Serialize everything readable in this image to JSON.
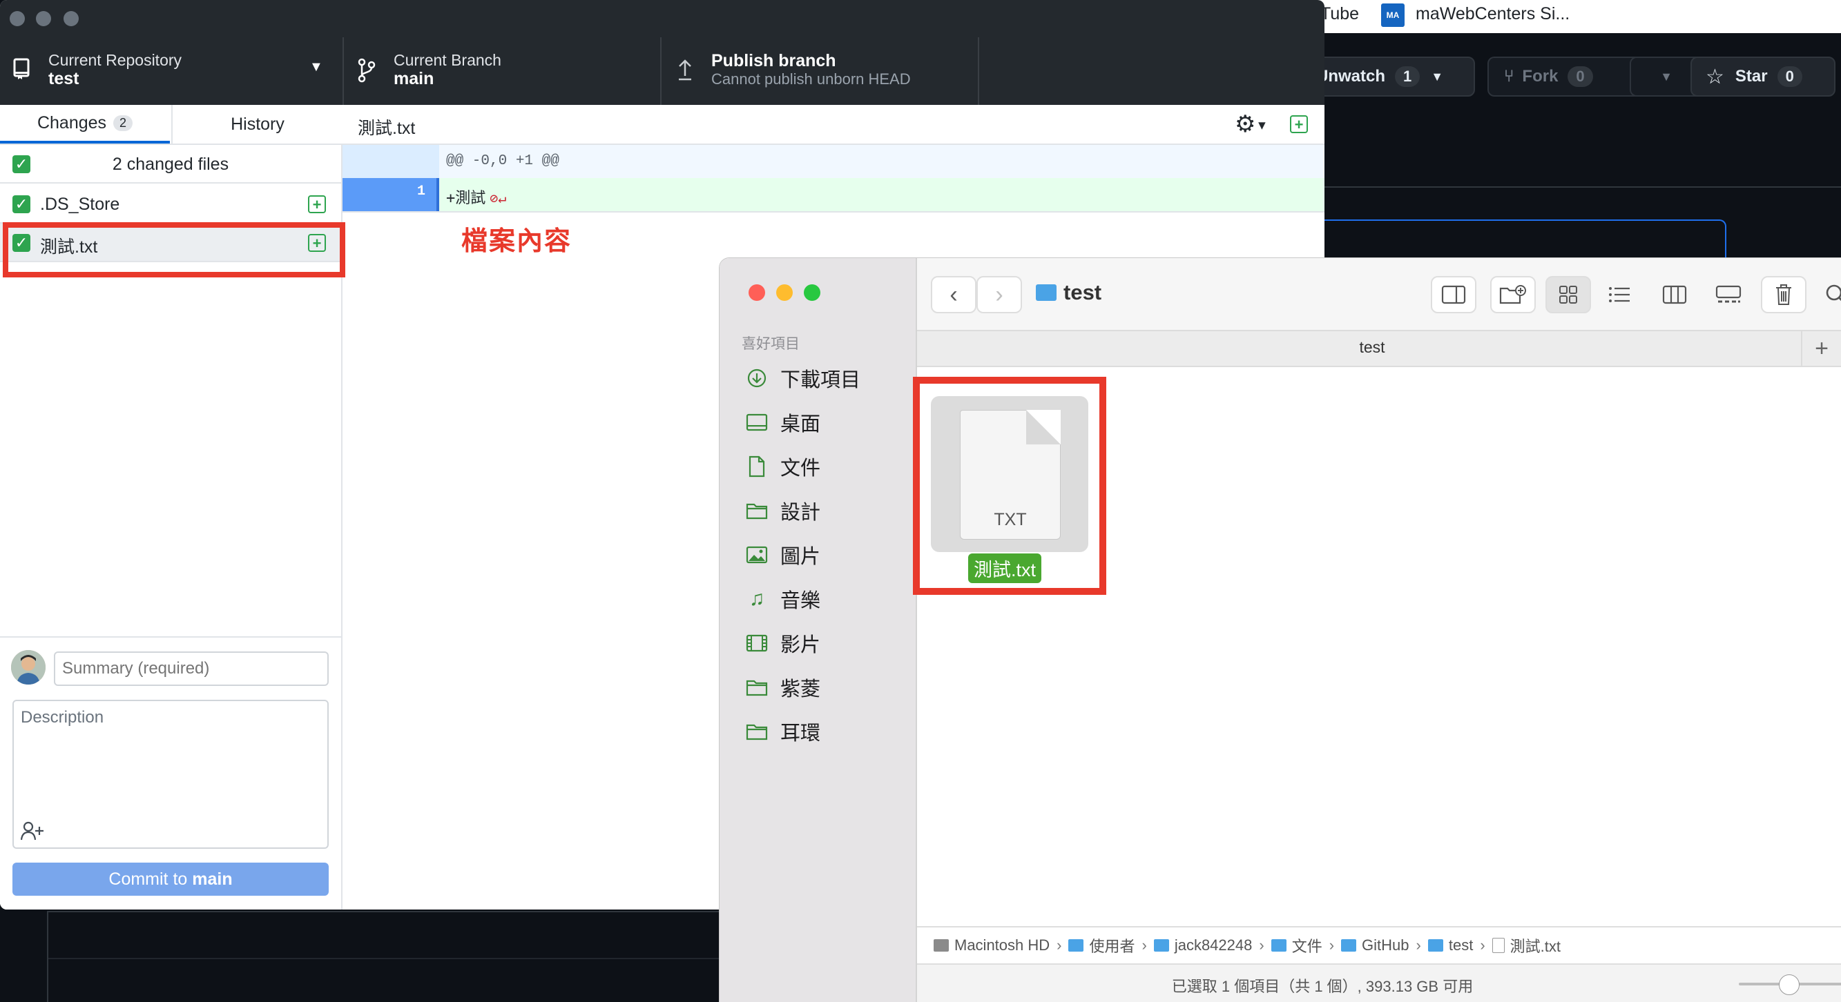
{
  "browser": {
    "bookmarks": [
      {
        "label": "Tube"
      },
      {
        "icon_text": "MA",
        "label": "maWebCenters Si..."
      }
    ]
  },
  "github": {
    "unwatch": {
      "label": "Unwatch",
      "count": "1"
    },
    "fork": {
      "label": "Fork",
      "count": "0"
    },
    "star": {
      "label": "Star",
      "count": "0"
    }
  },
  "desktop": {
    "repo": {
      "label": "Current Repository",
      "value": "test"
    },
    "branch": {
      "label": "Current Branch",
      "value": "main"
    },
    "publish": {
      "label": "Publish branch",
      "sub": "Cannot publish unborn HEAD"
    },
    "tabs": {
      "changes": "Changes",
      "changes_count": "2",
      "history": "History"
    },
    "changed_header": "2 changed files",
    "files": [
      {
        "name": ".DS_Store"
      },
      {
        "name": "測試.txt"
      }
    ],
    "diff": {
      "filename": "測試.txt",
      "hunk": "@@ -0,0 +1 @@",
      "line_number": "1",
      "line_text": "+測試",
      "eol_marker": "⊘↵"
    },
    "commit": {
      "summary_placeholder": "Summary (required)",
      "description_placeholder": "Description",
      "button_prefix": "Commit to ",
      "button_branch": "main"
    }
  },
  "annotation": {
    "label": "檔案內容"
  },
  "finder": {
    "title": "test",
    "tab_title": "test",
    "favorites_header": "喜好項目",
    "sidebar": [
      {
        "label": "下載項目",
        "icon": "download-icon"
      },
      {
        "label": "桌面",
        "icon": "desktop-icon"
      },
      {
        "label": "文件",
        "icon": "document-icon"
      },
      {
        "label": "設計",
        "icon": "folder-icon"
      },
      {
        "label": "圖片",
        "icon": "pictures-icon"
      },
      {
        "label": "音樂",
        "icon": "music-icon"
      },
      {
        "label": "影片",
        "icon": "movies-icon"
      },
      {
        "label": "紫菱",
        "icon": "folder-icon"
      },
      {
        "label": "耳環",
        "icon": "folder-icon"
      }
    ],
    "file": {
      "name": "測試.txt",
      "badge": "TXT"
    },
    "path": [
      "Macintosh HD",
      "使用者",
      "jack842248",
      "文件",
      "GitHub",
      "test",
      "測試.txt"
    ],
    "status": "已選取 1 個項目（共 1 個）, 393.13 GB 可用",
    "colors": {
      "close": "#ff5f57",
      "minimize": "#febc2e",
      "zoom": "#28c840",
      "tag_green": "#4aa830",
      "annotation_red": "#e8392b"
    }
  }
}
